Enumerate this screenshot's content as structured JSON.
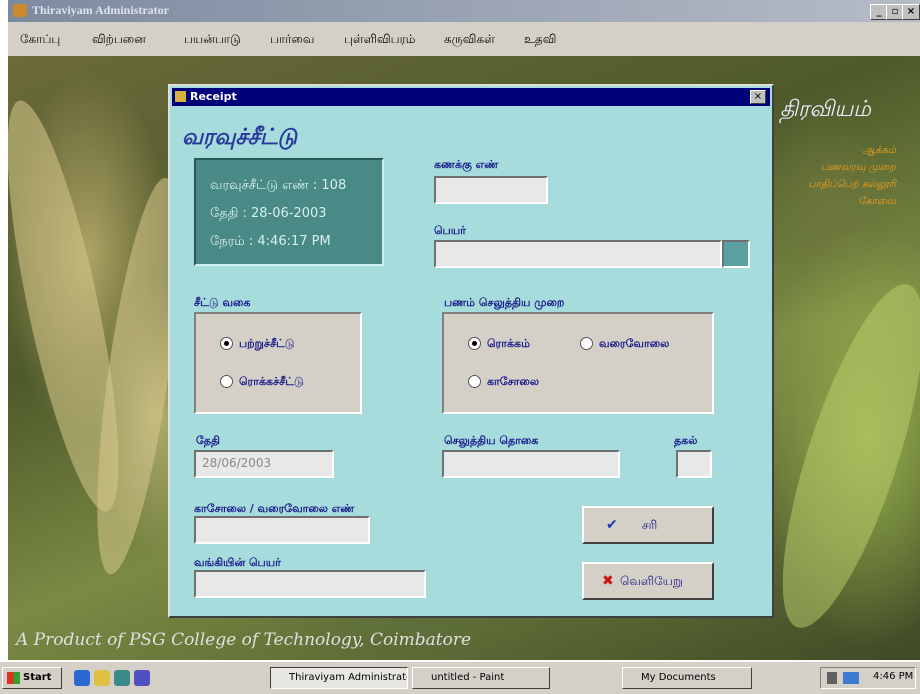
{
  "app": {
    "title": "Thiraviyam Administrator",
    "controls": {
      "minimize": "_",
      "maximize": "▫",
      "close": "×"
    },
    "menu": [
      "கோப்பு",
      "விற்பனை",
      "பயன்பாடு",
      "பார்வை",
      "புள்ளிவிபரம்",
      "கருவிகள்",
      "உதவி"
    ]
  },
  "background": {
    "side_title": "திரவியம்",
    "side_lines": [
      "ஆக்கம்",
      "பணவரவு முறை",
      "பாதிப்பெற் கல்லூரி",
      "கோவை"
    ],
    "footer": "A Product of PSG College of Technology, Coimbatore"
  },
  "dialog": {
    "title": "Receipt",
    "close": "×",
    "heading": "வரவுச்சீட்டு",
    "info": {
      "receipt_no": "வரவுச்சீட்டு எண் : 108",
      "date": "தேதி :  28-06-2003",
      "time": "நேரம் :  4:46:17 PM"
    },
    "account_no": {
      "label": "கணக்கு எண்",
      "value": ""
    },
    "name": {
      "label": "பெயர்",
      "value": ""
    },
    "receipt_type": {
      "label": "சீட்டு வகை",
      "options": [
        {
          "label": "பற்றுச்சீட்டு",
          "selected": true
        },
        {
          "label": "ரொக்கச்சீட்டு",
          "selected": false
        }
      ]
    },
    "payment_mode": {
      "label": "பணம் செலுத்திய முறை",
      "options": [
        {
          "label": "ரொக்கம்",
          "selected": true
        },
        {
          "label": "வரைவோலை",
          "selected": false
        },
        {
          "label": "காசோலை",
          "selected": false
        }
      ]
    },
    "date": {
      "label": "தேதி",
      "value": "28/06/2003"
    },
    "amount": {
      "label": "செலுத்திய தொகை",
      "value": ""
    },
    "unit": {
      "label": "தகல்",
      "value": ""
    },
    "cheque_no": {
      "label": "காசோலை / வரைவோலை எண்",
      "value": ""
    },
    "bank_name": {
      "label": "வங்கியின் பெயர்",
      "value": ""
    },
    "ok_button": {
      "icon": "✔",
      "label": "சரி"
    },
    "exit_button": {
      "icon": "✖",
      "label": "வெளியேறு"
    }
  },
  "taskbar": {
    "start": "Start",
    "tasks": [
      "Thiraviyam Administrator",
      "untitled - Paint",
      "My Documents"
    ],
    "clock": "4:46 PM"
  },
  "colors": {
    "dialog_bg": "#a6dcdc",
    "dialog_title": "#00007b",
    "label": "#1a1a8a",
    "info_box": "#4a8a86"
  }
}
